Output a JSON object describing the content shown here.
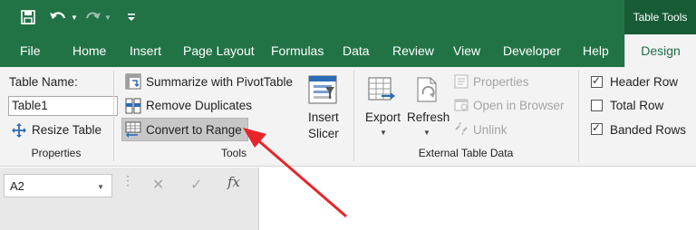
{
  "title_bar": {
    "quick_access": [
      "save-icon",
      "undo-icon",
      "redo-icon",
      "customize-qat-icon"
    ],
    "context_title": "Table Tools"
  },
  "tabs": [
    "File",
    "Home",
    "Insert",
    "Page Layout",
    "Formulas",
    "Data",
    "Review",
    "View",
    "Developer",
    "Help",
    "Design"
  ],
  "active_tab": "Design",
  "ribbon": {
    "properties": {
      "table_name_label": "Table Name:",
      "table_name_value": "Table1",
      "resize_table": "Resize Table",
      "group_label": "Properties"
    },
    "tools": {
      "summarize_pivot": "Summarize with PivotTable",
      "remove_duplicates": "Remove Duplicates",
      "convert_to_range": "Convert to Range",
      "insert_slicer_line1": "Insert",
      "insert_slicer_line2": "Slicer",
      "group_label": "Tools"
    },
    "external": {
      "export": "Export",
      "refresh": "Refresh",
      "properties": "Properties",
      "open_in_browser": "Open in Browser",
      "unlink": "Unlink",
      "group_label": "External Table Data"
    },
    "style_options": {
      "header_row": "Header Row",
      "header_row_checked": true,
      "total_row": "Total Row",
      "total_row_checked": false,
      "banded_rows": "Banded Rows",
      "banded_rows_checked": true
    }
  },
  "formula_bar": {
    "name_box": "A2",
    "cancel_symbol": "✕",
    "enter_symbol": "✓",
    "fx_label": "fx",
    "value": ""
  },
  "colors": {
    "excel_green": "#217346",
    "context_green": "#185c37",
    "arrow_red": "#e8242b"
  }
}
